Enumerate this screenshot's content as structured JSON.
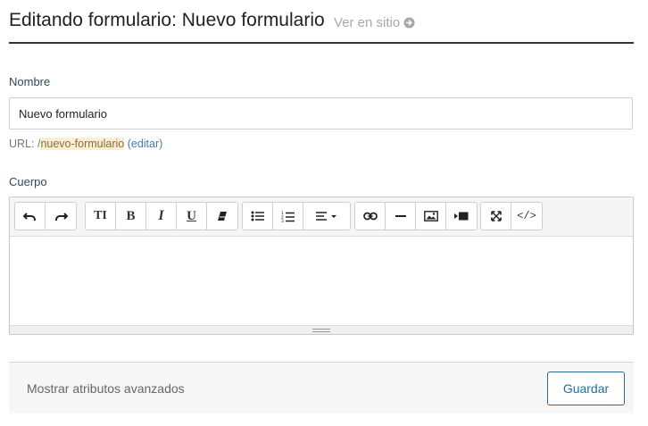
{
  "header": {
    "title": "Editando formulario: Nuevo formulario",
    "view_link": "Ver en sitio"
  },
  "name_field": {
    "label": "Nombre",
    "value": "Nuevo formulario"
  },
  "url": {
    "prefix": "URL: /",
    "slug": "nuevo-formulario",
    "edit_label": "(editar)"
  },
  "body_field": {
    "label": "Cuerpo"
  },
  "toolbar": {
    "groups": [
      [
        "undo-icon",
        "redo-icon"
      ],
      [
        "text-size-icon",
        "bold-icon",
        "italic-icon",
        "underline-icon",
        "eraser-icon"
      ],
      [
        "unordered-list-icon",
        "ordered-list-icon",
        "align-icon"
      ],
      [
        "link-icon",
        "horizontal-rule-icon",
        "image-icon",
        "video-icon"
      ],
      [
        "fullscreen-icon",
        "code-view-icon"
      ]
    ],
    "text_size_glyph": "TI",
    "bold_glyph": "B",
    "italic_glyph": "I",
    "underline_glyph": "U",
    "code_glyph": "</>"
  },
  "footer": {
    "advanced_label": "Mostrar atributos avanzados",
    "save_label": "Guardar"
  },
  "colors": {
    "accent": "#1f6ea3",
    "label": "#2d4a5a",
    "slug_highlight": "#fbefd3",
    "link": "#3f7fa6"
  }
}
